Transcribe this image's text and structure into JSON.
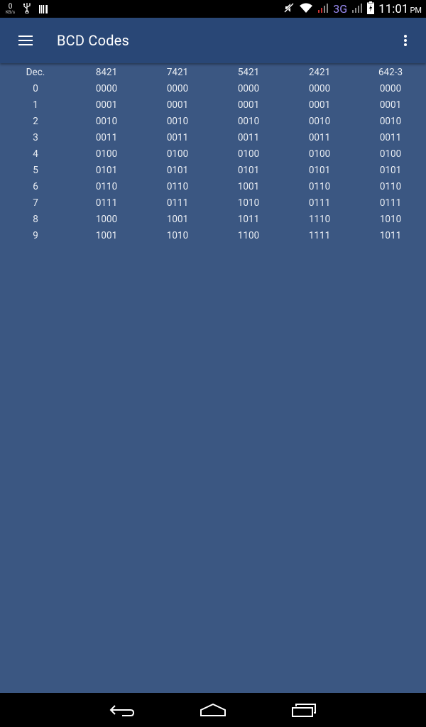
{
  "status_bar": {
    "kbs_value": "0",
    "kbs_unit": "KB/s",
    "network_type": "3G",
    "time": "11:01",
    "ampm": "PM",
    "icons": [
      "usb-icon",
      "barcode-icon",
      "mute-icon",
      "wifi-icon",
      "signal-icon",
      "battery-charging-icon"
    ]
  },
  "toolbar": {
    "title": "BCD Codes",
    "menu_icon": "hamburger-menu-icon",
    "overflow_icon": "overflow-menu-icon"
  },
  "table": {
    "headers": [
      "Dec.",
      "8421",
      "7421",
      "5421",
      "2421",
      "642-3"
    ],
    "rows": [
      [
        "0",
        "0000",
        "0000",
        "0000",
        "0000",
        "0000"
      ],
      [
        "1",
        "0001",
        "0001",
        "0001",
        "0001",
        "0001"
      ],
      [
        "2",
        "0010",
        "0010",
        "0010",
        "0010",
        "0010"
      ],
      [
        "3",
        "0011",
        "0011",
        "0011",
        "0011",
        "0011"
      ],
      [
        "4",
        "0100",
        "0100",
        "0100",
        "0100",
        "0100"
      ],
      [
        "5",
        "0101",
        "0101",
        "0101",
        "0101",
        "0101"
      ],
      [
        "6",
        "0110",
        "0110",
        "1001",
        "0110",
        "0110"
      ],
      [
        "7",
        "0111",
        "0111",
        "1010",
        "0111",
        "0111"
      ],
      [
        "8",
        "1000",
        "1001",
        "1011",
        "1110",
        "1010"
      ],
      [
        "9",
        "1001",
        "1010",
        "1100",
        "1111",
        "1011"
      ]
    ]
  },
  "nav_bar": {
    "icons": [
      "back-icon",
      "home-icon",
      "recent-apps-icon"
    ]
  },
  "colors": {
    "background": "#3b5782",
    "toolbar": "#294776",
    "text": "#e8ecf2"
  }
}
